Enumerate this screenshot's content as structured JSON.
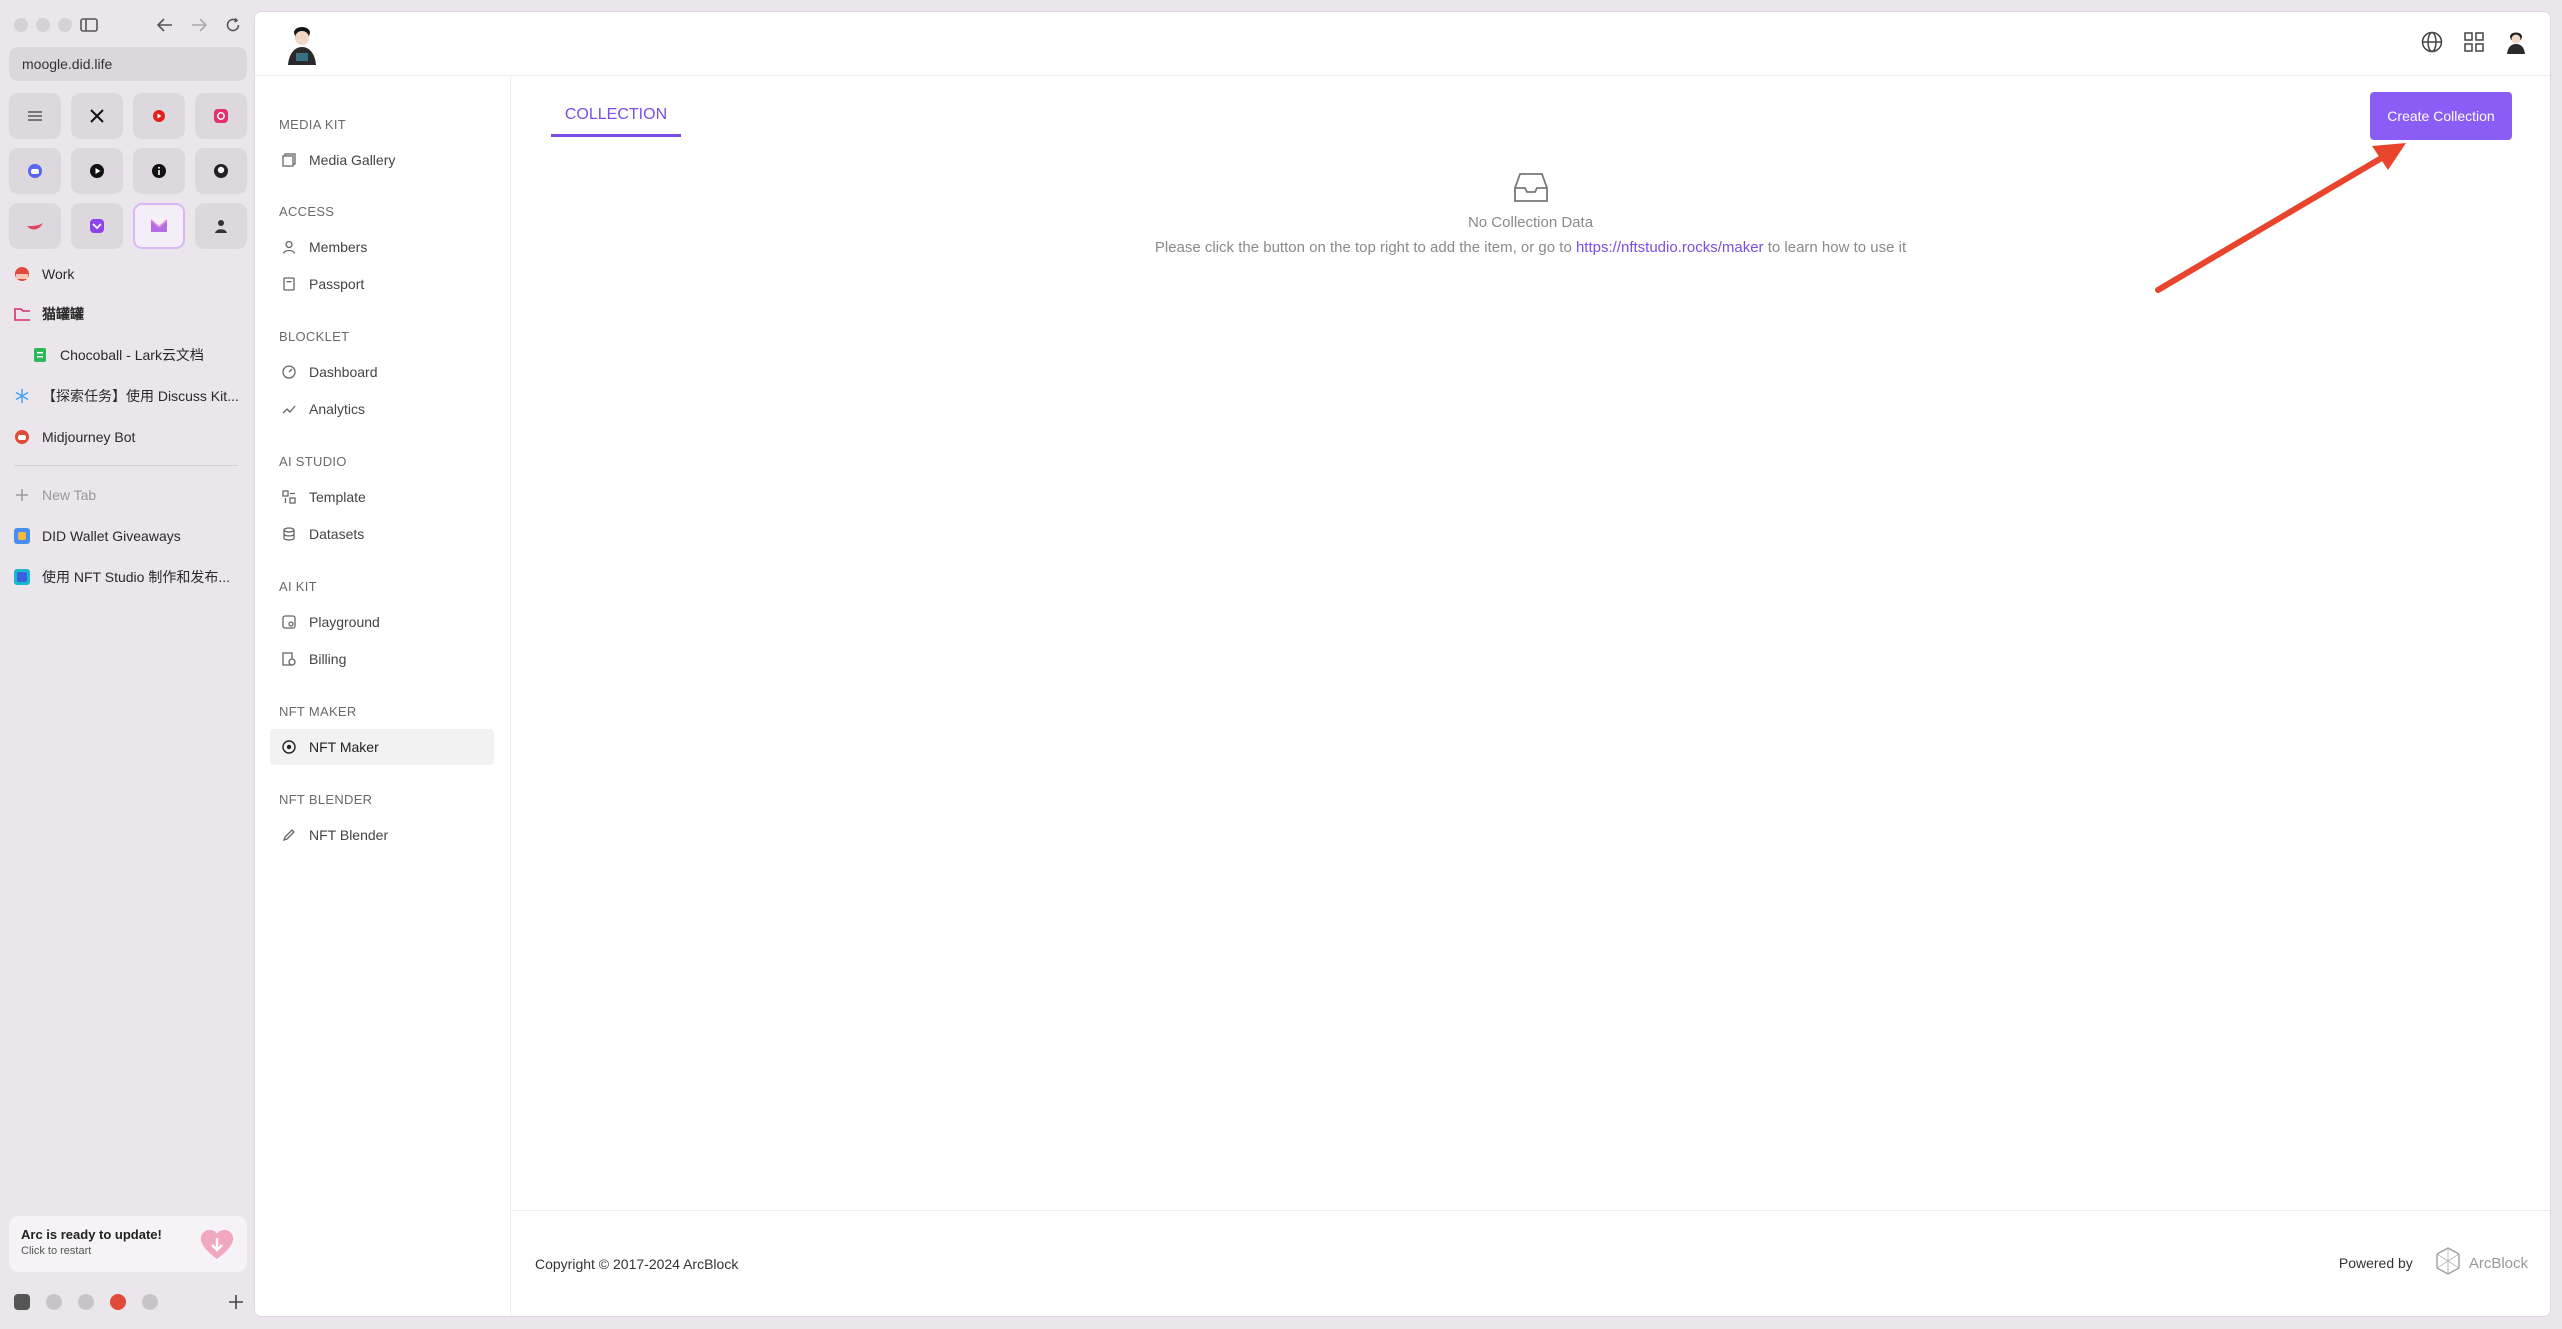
{
  "browser": {
    "url": "moogle.did.life",
    "pinned_icons": [
      "notion-icon",
      "x-icon",
      "youtube-icon",
      "instagram-icon",
      "discord-icon",
      "play-icon",
      "info-icon",
      "github-icon",
      "bird-icon",
      "pocket-icon",
      "mail-icon",
      "avatar-icon"
    ],
    "tabs": [
      {
        "label": "Work",
        "icon": "red-dot-icon",
        "color": "#e04a3a"
      },
      {
        "label": "猫罐罐",
        "icon": "folder-icon",
        "color": "#d8306b"
      },
      {
        "label": "Chocoball - Lark云文档",
        "icon": "doc-icon",
        "color": "#2fb85a"
      },
      {
        "label": "【探索任务】使用 Discuss Kit...",
        "icon": "snowflake-icon",
        "color": "#4aa3f0"
      },
      {
        "label": "Midjourney Bot",
        "icon": "discord-icon",
        "color": "#e04a3a"
      }
    ],
    "new_tab_label": "New Tab",
    "bottom_tabs": [
      {
        "label": "DID Wallet Giveaways",
        "icon": "wallet-icon",
        "color": "#4a8df0"
      },
      {
        "label": "使用 NFT Studio 制作和发布...",
        "icon": "nft-icon",
        "color": "#18b7c9"
      }
    ],
    "update": {
      "title": "Arc is ready to update!",
      "subtitle": "Click to restart"
    }
  },
  "sidebar": {
    "groups": [
      {
        "title": "MEDIA KIT",
        "items": [
          {
            "label": "Media Gallery",
            "icon": "gallery-icon"
          }
        ]
      },
      {
        "title": "ACCESS",
        "items": [
          {
            "label": "Members",
            "icon": "user-icon"
          },
          {
            "label": "Passport",
            "icon": "passport-icon"
          }
        ]
      },
      {
        "title": "BLOCKLET",
        "items": [
          {
            "label": "Dashboard",
            "icon": "dashboard-icon"
          },
          {
            "label": "Analytics",
            "icon": "analytics-icon"
          }
        ]
      },
      {
        "title": "AI STUDIO",
        "items": [
          {
            "label": "Template",
            "icon": "template-icon"
          },
          {
            "label": "Datasets",
            "icon": "database-icon"
          }
        ]
      },
      {
        "title": "AI KIT",
        "items": [
          {
            "label": "Playground",
            "icon": "playground-icon"
          },
          {
            "label": "Billing",
            "icon": "billing-icon"
          }
        ]
      },
      {
        "title": "NFT MAKER",
        "items": [
          {
            "label": "NFT Maker",
            "icon": "nft-maker-icon",
            "selected": true
          }
        ]
      },
      {
        "title": "NFT BLENDER",
        "items": [
          {
            "label": "NFT Blender",
            "icon": "pen-icon"
          }
        ]
      }
    ]
  },
  "main": {
    "tab_label": "COLLECTION",
    "create_button": "Create Collection",
    "empty_title": "No Collection Data",
    "empty_desc_before": "Please click the button on the top right to add the item, or go to",
    "empty_link": "https://nftstudio.rocks/maker",
    "empty_desc_after": "to learn how to use it"
  },
  "footer": {
    "copyright": "Copyright © 2017-2024  ArcBlock",
    "powered_by": "Powered by",
    "brand": "ArcBlock"
  },
  "colors": {
    "accent": "#8b5cf6",
    "annotation_arrow": "#e8452c"
  }
}
